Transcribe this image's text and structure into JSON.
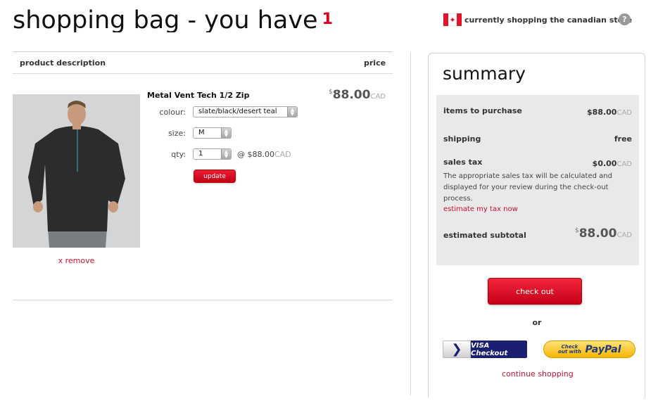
{
  "header": {
    "title": "shopping bag - you have",
    "item_count": "1",
    "store_text": "currently shopping the canadian store",
    "help_label": "?"
  },
  "cart": {
    "col_description": "product description",
    "col_price": "price",
    "item": {
      "name": "Metal Vent Tech 1/2 Zip",
      "currency_symbol": "$",
      "price": "88.00",
      "currency": "CAD",
      "colour_label": "colour:",
      "colour_value": "slate/black/desert teal",
      "size_label": "size:",
      "size_value": "M",
      "qty_label": "qty:",
      "qty_value": "1",
      "unit_price": "@ $88.00",
      "update_label": "update",
      "remove_label": "x remove"
    }
  },
  "summary": {
    "title": "summary",
    "items_label": "items to purchase",
    "items_value": "$88.00",
    "shipping_label": "shipping",
    "shipping_value": "free",
    "tax_label": "sales tax",
    "tax_value": "$0.00",
    "tax_note": "The appropriate sales tax will be calculated and displayed for your review during the check-out process.",
    "tax_link": "estimate my tax now",
    "subtotal_label": "estimated subtotal",
    "subtotal_symbol": "$",
    "subtotal_value": "88.00",
    "currency": "CAD",
    "checkout_label": "check out",
    "or_label": "or",
    "visa_label": "VISA Checkout",
    "paypal_small": "Check out with",
    "paypal_label": "PayPal",
    "continue_label": "continue shopping"
  },
  "colors": {
    "accent": "#d6001c",
    "link": "#c8102e",
    "panel": "#e9e9e9"
  },
  "icons": [
    "canada-flag-icon",
    "help-icon",
    "select-arrow-icon",
    "visa-chevron-icon"
  ]
}
